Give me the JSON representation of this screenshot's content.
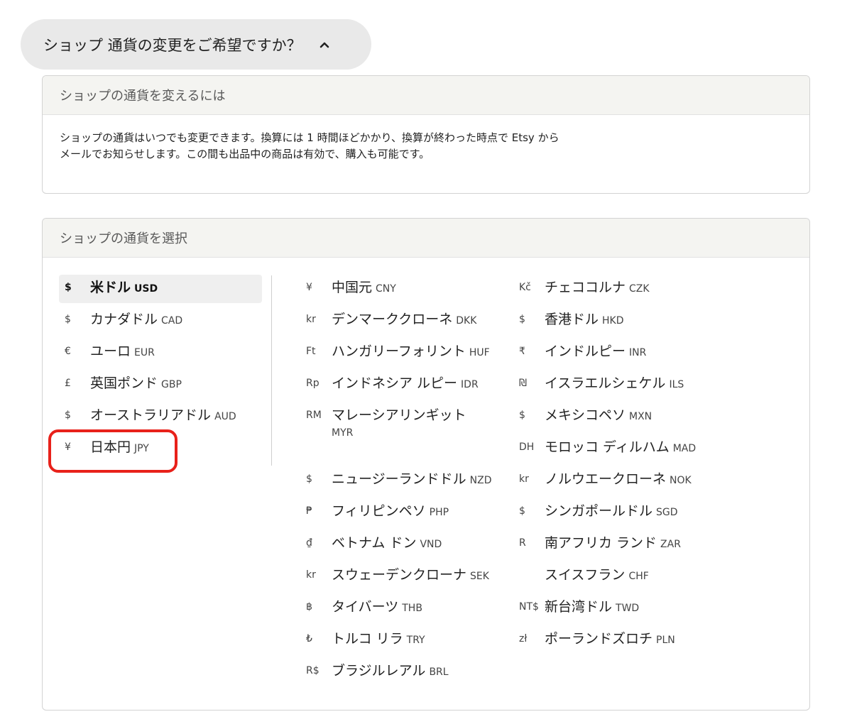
{
  "toggle": {
    "label": "ショップ 通貨の変更をご希望ですか？",
    "icon": "chevron-up-icon"
  },
  "info": {
    "header": "ショップの通貨を変えるには",
    "line1": "ショップの通貨はいつでも変更できます。換算には 1 時間ほどかかり、換算が終わった時点で Etsy から",
    "line2": "メールでお知らせします。この間も出品中の商品は有効で、購入も可能です。"
  },
  "select": {
    "header": "ショップの通貨を選択",
    "primary": [
      {
        "symbol": "$",
        "name": "米ドル",
        "code": "USD",
        "selected": true
      },
      {
        "symbol": "$",
        "name": "カナダドル",
        "code": "CAD"
      },
      {
        "symbol": "€",
        "name": "ユーロ",
        "code": "EUR"
      },
      {
        "symbol": "£",
        "name": "英国ポンド",
        "code": "GBP"
      },
      {
        "symbol": "$",
        "name": "オーストラリアドル",
        "code": "AUD"
      },
      {
        "symbol": "¥",
        "name": "日本円",
        "code": "JPY"
      }
    ],
    "column2": [
      {
        "symbol": "¥",
        "name": "中国元",
        "code": "CNY"
      },
      {
        "symbol": "kr",
        "name": "デンマーククローネ",
        "code": "DKK"
      },
      {
        "symbol": "Ft",
        "name": "ハンガリーフォリント",
        "code": "HUF"
      },
      {
        "symbol": "Rp",
        "name": "インドネシア ルピー",
        "code": "IDR"
      },
      {
        "symbol": "RM",
        "name": "マレーシアリンギット",
        "code": "MYR"
      },
      {
        "symbol": "$",
        "name": "ニュージーランドドル",
        "code": "NZD"
      },
      {
        "symbol": "₱",
        "name": "フィリピンペソ",
        "code": "PHP"
      },
      {
        "symbol": "₫",
        "name": "ベトナム ドン",
        "code": "VND"
      },
      {
        "symbol": "kr",
        "name": "スウェーデンクローナ",
        "code": "SEK"
      },
      {
        "symbol": "฿",
        "name": "タイバーツ",
        "code": "THB"
      },
      {
        "symbol": "₺",
        "name": "トルコ リラ",
        "code": "TRY"
      },
      {
        "symbol": "R$",
        "name": "ブラジルレアル",
        "code": "BRL"
      }
    ],
    "column3": [
      {
        "symbol": "Kč",
        "name": "チェココルナ",
        "code": "CZK"
      },
      {
        "symbol": "$",
        "name": "香港ドル",
        "code": "HKD"
      },
      {
        "symbol": "₹",
        "name": "インドルピー",
        "code": "INR"
      },
      {
        "symbol": "₪",
        "name": "イスラエルシェケル",
        "code": "ILS"
      },
      {
        "symbol": "$",
        "name": "メキシコペソ",
        "code": "MXN"
      },
      {
        "symbol": "DH",
        "name": "モロッコ ディルハム",
        "code": "MAD"
      },
      {
        "symbol": "kr",
        "name": "ノルウエークローネ",
        "code": "NOK"
      },
      {
        "symbol": "$",
        "name": "シンガポールドル",
        "code": "SGD"
      },
      {
        "symbol": "R",
        "name": "南アフリカ ランド",
        "code": "ZAR"
      },
      {
        "symbol": "",
        "name": "スイスフラン",
        "code": "CHF"
      },
      {
        "symbol": "NT$",
        "name": "新台湾ドル",
        "code": "TWD"
      },
      {
        "symbol": "zł",
        "name": "ポーランドズロチ",
        "code": "PLN"
      }
    ]
  },
  "colors": {
    "highlight": "#e8211a",
    "header_bg": "#f4f4f1",
    "toggle_bg": "#e9e9e9"
  }
}
